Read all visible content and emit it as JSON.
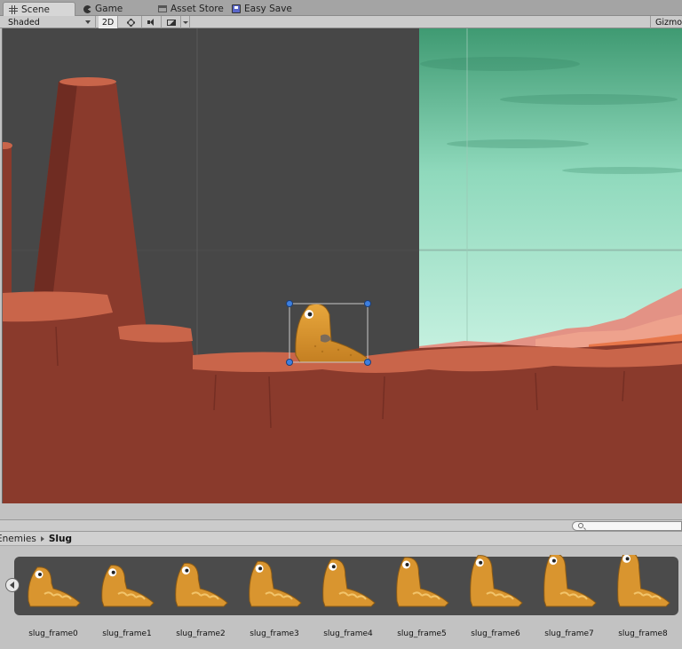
{
  "tabs": [
    {
      "label": "Scene",
      "icon": "grid-icon",
      "active": true
    },
    {
      "label": "Game",
      "icon": "pacman-icon",
      "active": false
    },
    {
      "label": "Asset Store",
      "icon": "store-icon",
      "active": false
    },
    {
      "label": "Easy Save",
      "icon": "floppy-icon",
      "active": false
    }
  ],
  "toolbar": {
    "render_mode": "Shaded",
    "mode_2d": "2D",
    "gizmos": "Gizmos"
  },
  "breadcrumb": {
    "root": "Enemies",
    "current": "Slug"
  },
  "frames": [
    "slug_frame0",
    "slug_frame1",
    "slug_frame2",
    "slug_frame3",
    "slug_frame4",
    "slug_frame5",
    "slug_frame6",
    "slug_frame7",
    "slug_frame8"
  ],
  "colors": {
    "viewport_bg": "#474747",
    "rock": "#8a3a2c",
    "rock_top": "#c9654a",
    "sky_top": "#3f9a72",
    "sky_bottom": "#bfeedd",
    "slug": "#d9952f",
    "selection_handle": "#3d7fe0"
  }
}
